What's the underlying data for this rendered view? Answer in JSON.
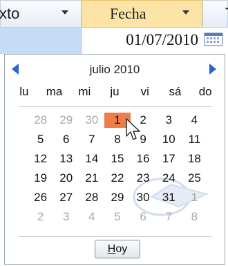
{
  "header": {
    "col_left": "xto",
    "col_mid": "Fecha",
    "col_right": "T"
  },
  "field": {
    "value": "01/07/2010"
  },
  "calendar": {
    "month_label": "julio 2010",
    "day_names": [
      "lu",
      "ma",
      "mi",
      "ju",
      "vi",
      "sá",
      "do"
    ],
    "weeks": [
      [
        "28",
        "29",
        "30",
        "1",
        "2",
        "3",
        "4"
      ],
      [
        "5",
        "6",
        "7",
        "8",
        "9",
        "10",
        "11"
      ],
      [
        "12",
        "13",
        "14",
        "15",
        "16",
        "17",
        "18"
      ],
      [
        "19",
        "20",
        "21",
        "22",
        "23",
        "24",
        "25"
      ],
      [
        "26",
        "27",
        "28",
        "29",
        "30",
        "31",
        "1"
      ],
      [
        "2",
        "3",
        "4",
        "5",
        "6",
        "7",
        "8"
      ]
    ],
    "other_month_cells": [
      [
        0,
        0
      ],
      [
        0,
        1
      ],
      [
        0,
        2
      ],
      [
        4,
        6
      ],
      [
        5,
        0
      ],
      [
        5,
        1
      ],
      [
        5,
        2
      ],
      [
        5,
        3
      ],
      [
        5,
        4
      ],
      [
        5,
        5
      ],
      [
        5,
        6
      ]
    ],
    "selected_cell": [
      0,
      3
    ],
    "today_button": "Hoy"
  },
  "colors": {
    "selected": "#f07c4b",
    "nav_arrow": "#2a66c9",
    "header_active": "#fce4a6"
  }
}
